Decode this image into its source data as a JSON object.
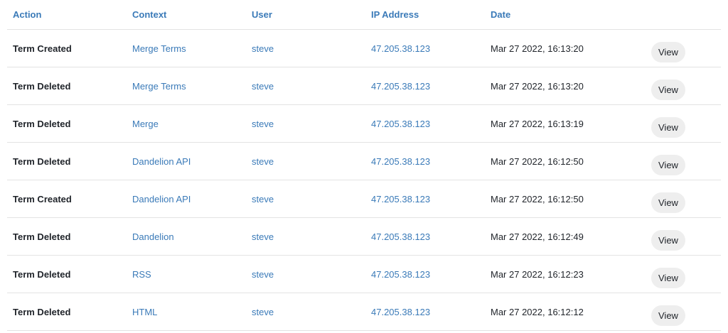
{
  "columns": {
    "action": "Action",
    "context": "Context",
    "user": "User",
    "ip": "IP Address",
    "date": "Date"
  },
  "view_label": "View",
  "rows": [
    {
      "action": "Term Created",
      "context": "Merge Terms",
      "user": "steve",
      "ip": "47.205.38.123",
      "date": "Mar 27 2022, 16:13:20"
    },
    {
      "action": "Term Deleted",
      "context": "Merge Terms",
      "user": "steve",
      "ip": "47.205.38.123",
      "date": "Mar 27 2022, 16:13:20"
    },
    {
      "action": "Term Deleted",
      "context": "Merge",
      "user": "steve",
      "ip": "47.205.38.123",
      "date": "Mar 27 2022, 16:13:19"
    },
    {
      "action": "Term Deleted",
      "context": "Dandelion API",
      "user": "steve",
      "ip": "47.205.38.123",
      "date": "Mar 27 2022, 16:12:50"
    },
    {
      "action": "Term Created",
      "context": "Dandelion API",
      "user": "steve",
      "ip": "47.205.38.123",
      "date": "Mar 27 2022, 16:12:50"
    },
    {
      "action": "Term Deleted",
      "context": "Dandelion",
      "user": "steve",
      "ip": "47.205.38.123",
      "date": "Mar 27 2022, 16:12:49"
    },
    {
      "action": "Term Deleted",
      "context": "RSS",
      "user": "steve",
      "ip": "47.205.38.123",
      "date": "Mar 27 2022, 16:12:23"
    },
    {
      "action": "Term Deleted",
      "context": "HTML",
      "user": "steve",
      "ip": "47.205.38.123",
      "date": "Mar 27 2022, 16:12:12"
    }
  ]
}
